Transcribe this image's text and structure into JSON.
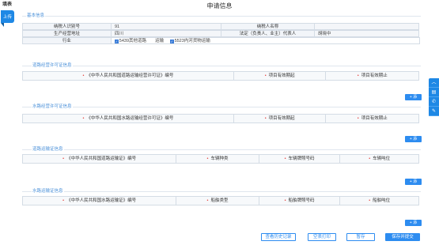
{
  "corner_label": "填表",
  "upload_tab": "上传",
  "title": "申请信息",
  "basic": {
    "section_title": "基本信息",
    "taxpayer_id_label": "纳税人识别号",
    "taxpayer_id_value": "91",
    "taxpayer_name_label": "纳税人名称",
    "address_label": "生产经营地址",
    "address_value": "四川",
    "legal_rep_label": "法定（负责人、业主）代表人",
    "legal_rep_value": "胡晓中",
    "industry_label": "行业",
    "industries": [
      {
        "label": "5439其他道路　　运输"
      },
      {
        "label": "5523内河货物运输"
      }
    ]
  },
  "road_license": {
    "section_title": "道路经营许可证信息",
    "columns": [
      "《中华人民共和国道路运输经营许可证》编号",
      "项目有效期起",
      "项目有效期止"
    ],
    "add_label": "+ 添"
  },
  "water_license": {
    "section_title": "水路经营许可证信息",
    "columns": [
      "《中华人民共和国水路运输经营许可证》编号",
      "项目有效期起",
      "项目有效期止"
    ],
    "add_label": "+ 添"
  },
  "road_transport": {
    "section_title": "道路运输证信息",
    "columns": [
      "《中华人民共和国道路运输证》编号",
      "车辆种类",
      "车辆牌照号码",
      "车辆吨位"
    ],
    "add_label": "+ 添"
  },
  "water_transport": {
    "section_title": "水路运输证信息",
    "columns": [
      "《中华人民共和国水路运输证》编号",
      "船舶类型",
      "船舶牌照号码",
      "船舶吨位"
    ],
    "add_label": "+ 添"
  },
  "footer": {
    "history": "查看历史记录",
    "print": "空表打印",
    "save": "暂存",
    "submit": "保存并提交"
  },
  "side_tools": [
    {
      "icon": "chevron-up-icon",
      "glyph": "︿"
    },
    {
      "icon": "document-icon",
      "glyph": "▤"
    },
    {
      "icon": "phone-icon",
      "glyph": "✆"
    },
    {
      "icon": "edit-icon",
      "glyph": "✎"
    }
  ]
}
